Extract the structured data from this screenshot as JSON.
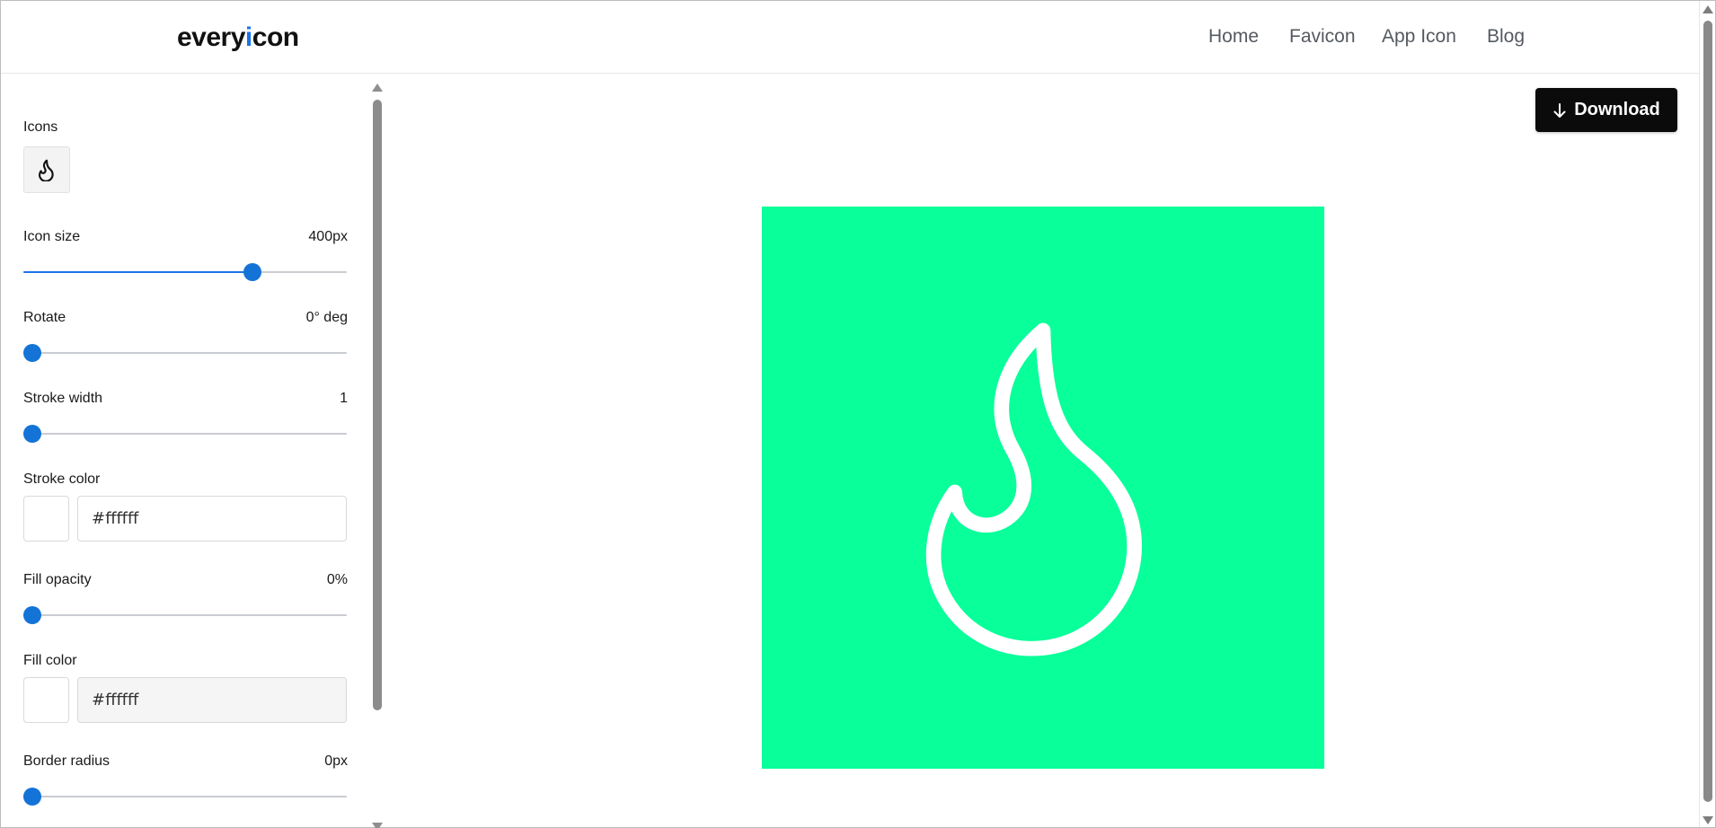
{
  "header": {
    "logo_before": "every",
    "logo_accent": "i",
    "logo_after": "con",
    "nav": [
      {
        "label": "Home"
      },
      {
        "label": "Favicon"
      },
      {
        "label": "App Icon"
      },
      {
        "label": "Blog"
      }
    ]
  },
  "sidebar": {
    "icons_label": "Icons",
    "selected_icon": "flame-icon",
    "icon_size": {
      "label": "Icon size",
      "value": "400px",
      "level": 0.72
    },
    "rotate": {
      "label": "Rotate",
      "value": "0° deg",
      "level": 0
    },
    "stroke_width": {
      "label": "Stroke width",
      "value": "1",
      "level": 0
    },
    "stroke_color": {
      "label": "Stroke color",
      "value": "#ffffff"
    },
    "fill_opacity": {
      "label": "Fill opacity",
      "value": "0%",
      "level": 0
    },
    "fill_color": {
      "label": "Fill color",
      "value": "#ffffff"
    },
    "border_radius": {
      "label": "Border radius",
      "value": "0px",
      "level": 0
    }
  },
  "main": {
    "download_label": "Download",
    "preview_background": "#08ff9a",
    "preview_stroke": "#ffffff"
  },
  "colors": {
    "accent": "#1473d6",
    "button_bg": "#0b0b0b"
  }
}
